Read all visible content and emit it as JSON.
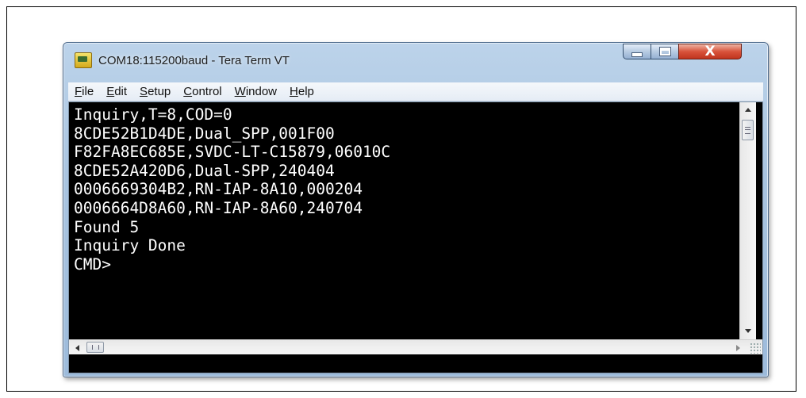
{
  "window": {
    "title": "COM18:115200baud - Tera Term VT",
    "controls": {
      "minimize_icon": "minimize-icon",
      "maximize_icon": "maximize-icon",
      "close_label": "X"
    }
  },
  "menu": {
    "items": [
      {
        "label": "File"
      },
      {
        "label": "Edit"
      },
      {
        "label": "Setup"
      },
      {
        "label": "Control"
      },
      {
        "label": "Window"
      },
      {
        "label": "Help"
      }
    ]
  },
  "terminal": {
    "lines": [
      "Inquiry,T=8,COD=0",
      "8CDE52B1D4DE,Dual_SPP,001F00",
      "F82FA8EC685E,SVDC-LT-C15879,06010C",
      "8CDE52A420D6,Dual-SPP,240404",
      "0006669304B2,RN-IAP-8A10,000204",
      "0006664D8A60,RN-IAP-8A60,240704",
      "Found 5",
      "Inquiry Done",
      "CMD>"
    ],
    "background": "#000000",
    "foreground": "#ffffff"
  },
  "scrollbars": {
    "vertical_icons": [
      "scroll-up-icon",
      "scroll-down-icon"
    ],
    "horizontal_icons": [
      "scroll-left-icon",
      "scroll-right-icon"
    ]
  },
  "colors": {
    "title_bar": "#a9c4e0",
    "close_button": "#d8533b"
  }
}
